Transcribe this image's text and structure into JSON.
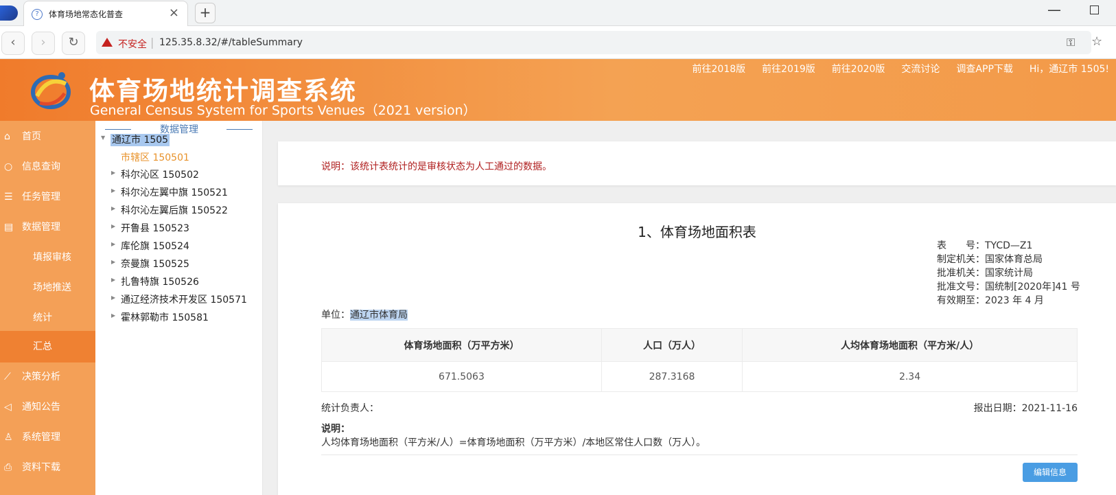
{
  "browser": {
    "tab_title": "体育场地常态化普查",
    "tab_close": "×",
    "new_tab": "+",
    "insecure": "不安全",
    "url": "125.35.8.32/#/tableSummary"
  },
  "header": {
    "title": "体育场地统计调查系统",
    "subtitle": "General Census System for Sports Venues（2021 version）",
    "nav": [
      "前往2018版",
      "前往2019版",
      "前往2020版",
      "交流讨论",
      "调查APP下载",
      "Hi，通辽市 1505!"
    ]
  },
  "sidebar": {
    "items": [
      {
        "icon": "home-icon",
        "label": "首页"
      },
      {
        "icon": "search-icon",
        "label": "信息查询"
      },
      {
        "icon": "task-icon",
        "label": "任务管理"
      },
      {
        "icon": "data-icon",
        "label": "数据管理"
      },
      {
        "label": "填报审核"
      },
      {
        "label": "场地推送"
      },
      {
        "label": "统计"
      },
      {
        "label": "汇总"
      },
      {
        "icon": "chart-icon",
        "label": "决策分析"
      },
      {
        "icon": "speaker-icon",
        "label": "通知公告"
      },
      {
        "icon": "user-icon",
        "label": "系统管理"
      },
      {
        "icon": "download-icon",
        "label": "资料下载"
      }
    ]
  },
  "tree": {
    "header": "数据管理",
    "root": "通辽市 1505",
    "nodes": [
      "市辖区 150501",
      "科尔沁区 150502",
      "科尔沁左翼中旗 150521",
      "科尔沁左翼后旗 150522",
      "开鲁县 150523",
      "库伦旗 150524",
      "奈曼旗 150525",
      "扎鲁特旗 150526",
      "通辽经济技术开发区 150571",
      "霍林郭勒市 150581"
    ]
  },
  "notice": "说明：该统计表统计的是审核状态为人工通过的数据。",
  "report": {
    "title": "1、体育场地面积表",
    "meta": [
      "表　　号：TYCD—Z1",
      "制定机关：国家体育总局",
      "批准机关：国家统计局",
      "批准文号：国统制[2020年]41 号",
      "有效期至：2023 年 4 月"
    ],
    "unit_label": "单位：",
    "unit_value": "通辽市体育局",
    "columns": [
      "体育场地面积（万平方米）",
      "人口（万人）",
      "人均体育场地面积（平方米/人）"
    ],
    "row": [
      "671.5063",
      "287.3168",
      "2.34"
    ],
    "signer": "统计负责人：",
    "report_date": "报出日期：2021-11-16",
    "note_title": "说明：",
    "note_text": "人均体育场地面积（平方米/人）=体育场地面积（万平方米）/本地区常住人口数（万人）。",
    "edit_button": "编辑信息"
  }
}
